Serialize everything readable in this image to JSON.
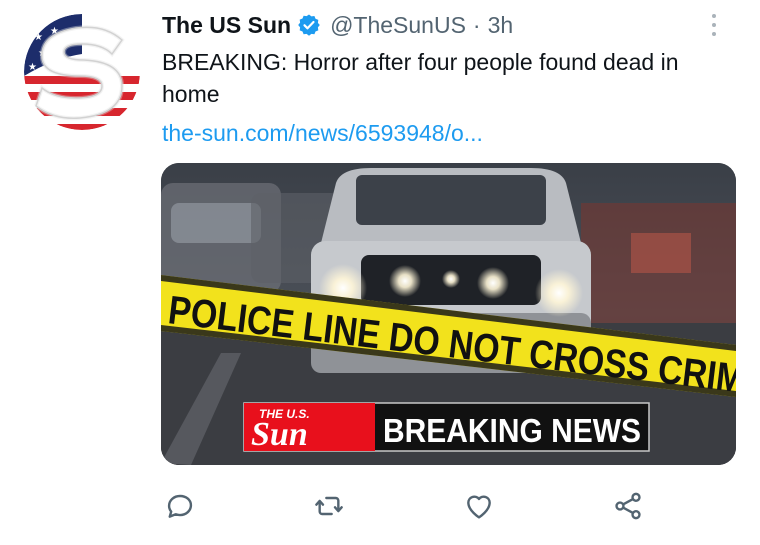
{
  "tweet": {
    "author": {
      "display_name": "The US Sun",
      "handle": "@TheSunUS",
      "verified": true,
      "avatar_icon": "the-us-sun-logo-icon"
    },
    "separator": "·",
    "time": "3h",
    "text": "BREAKING: Horror after four people found dead in home",
    "link": "the-sun.com/news/6593948/o...",
    "media": {
      "tape_text": "POLICE LINE DO NOT CROSS CRIM",
      "logo_small": "THE U.S.",
      "logo_big": "Sun",
      "banner_text": "BREAKING NEWS"
    },
    "actions": [
      {
        "name": "reply",
        "icon": "reply-icon"
      },
      {
        "name": "retweet",
        "icon": "retweet-icon"
      },
      {
        "name": "like",
        "icon": "heart-icon"
      },
      {
        "name": "share",
        "icon": "share-icon"
      }
    ],
    "colors": {
      "link": "#1d9bf0",
      "secondary_text": "#536471",
      "verified": "#1d9bf0",
      "action_icons": "#536471",
      "tape": "#f2e21c",
      "sun_red": "#e8101c"
    }
  }
}
